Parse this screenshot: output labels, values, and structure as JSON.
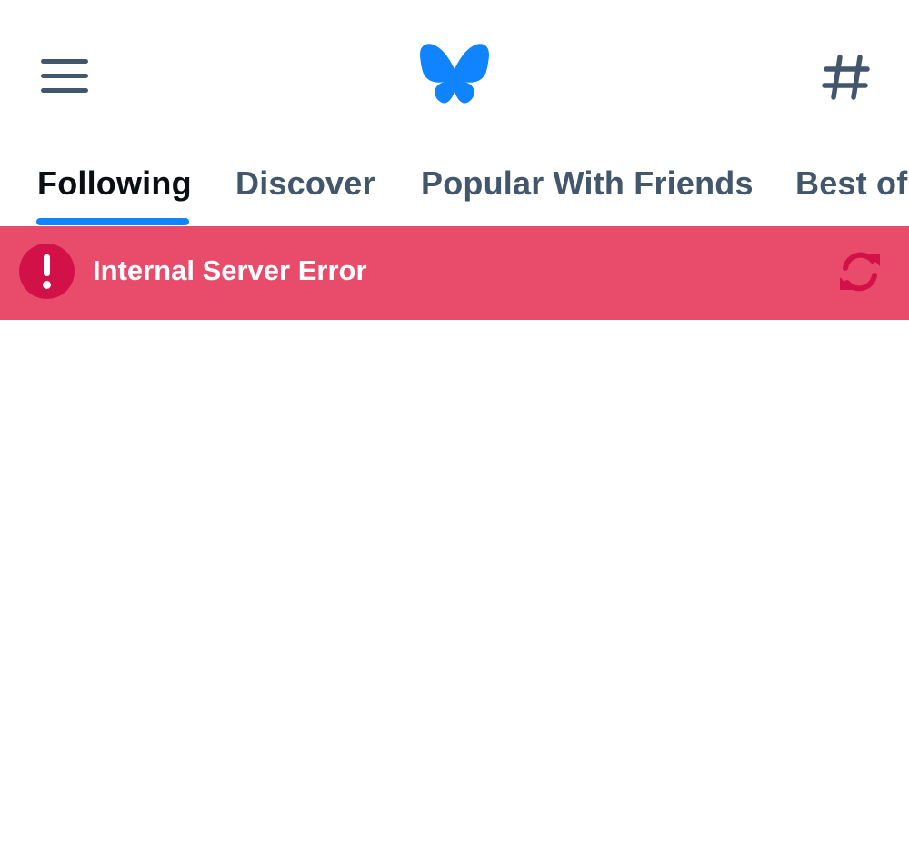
{
  "header": {
    "menu_icon": "hamburger-menu-icon",
    "logo_icon": "butterfly-logo-icon",
    "hashtag_icon": "hashtag-icon",
    "logo_color": "#1083fe"
  },
  "tabs": [
    {
      "label": "Following",
      "active": true
    },
    {
      "label": "Discover",
      "active": false
    },
    {
      "label": "Popular With Friends",
      "active": false
    },
    {
      "label": "Best of",
      "active": false
    }
  ],
  "error": {
    "message": "Internal Server Error",
    "icon": "exclamation-circle-icon",
    "retry_icon": "refresh-icon",
    "banner_color": "#e94b6b",
    "accent_color": "#d21148"
  },
  "colors": {
    "tab_active": "#0b0f14",
    "tab_inactive": "#42576c",
    "tab_indicator": "#1083fe"
  }
}
